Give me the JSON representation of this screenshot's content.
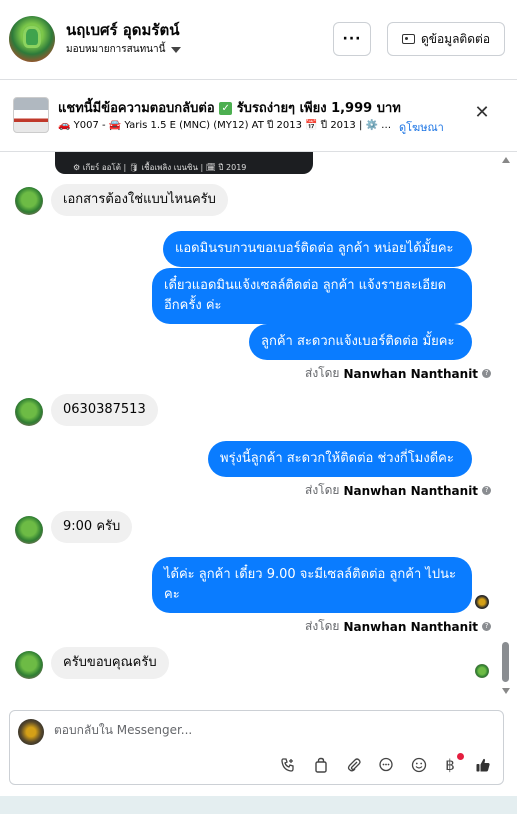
{
  "header": {
    "contact_name": "นฤเบศร์ อุดมรัตน์",
    "assign_label": "มอบหมายการสนทนานี้",
    "more_label": "···",
    "contact_button_label": "ดูข้อมูลติดต่อ"
  },
  "ad": {
    "title": "แชทนี้มีข้อความตอบกลับต่อ",
    "title_suffix": "รับรถง่ายๆ เพียง 1,999 บาท",
    "subtitle": "🚗 Y007 - 🚘 Yaris 1.5 E (MNC) (MY12) AT ปี 2013 📅 ปี 2013 | ⚙️ เ...",
    "view_ad_label": "ดูโฆษณา"
  },
  "media_caption": "⚙ เกียร์ ออโต้  |  🛢 เชื้อเพลิง เบนซิน  |  🗓 ปี 2019",
  "messages": [
    {
      "type": "in",
      "text": "เอกสารต้องใช่แบบไหนครับ"
    },
    {
      "type": "out",
      "text": "แอดมินรบกวนขอเบอร์ติดต่อ ลูกค้า หน่อยได้มั้ยคะ"
    },
    {
      "type": "out",
      "text": "เดี๋ยวแอดมินแจ้งเซลล์ติดต่อ ลูกค้า แจ้งรายละเอียดอีกครั้ง ค่ะ"
    },
    {
      "type": "out",
      "text": "ลูกค้า สะดวกแจ้งเบอร์ติดต่อ มั้ยคะ"
    },
    {
      "type": "in",
      "text": "0630387513"
    },
    {
      "type": "out",
      "text": "พรุ่งนี้ลูกค้า สะดวกให้ติดต่อ ช่วงกี่โมงดีคะ"
    },
    {
      "type": "in",
      "text": "9:00  ครับ"
    },
    {
      "type": "out",
      "text": "ได้ค่ะ  ลูกค้า เดี๋ยว 9.00 จะมีเซลล์ติดต่อ ลูกค้า ไปนะคะ"
    },
    {
      "type": "in",
      "text": "ครับขอบคุณครับ"
    }
  ],
  "sent_by": {
    "prefix": "ส่งโดย",
    "name": "Nanwhan Nanthanit"
  },
  "composer": {
    "placeholder": "ตอบกลับใน Messenger..."
  },
  "icons": {
    "more": "more-horizontal-icon",
    "contact": "contact-card-icon",
    "close": "close-icon",
    "call": "call-add-icon",
    "bag": "shopping-bag-icon",
    "attach": "paperclip-icon",
    "saved_reply": "chat-bubble-icon",
    "emoji": "emoji-icon",
    "payment": "baht-icon",
    "like": "thumbs-up-icon"
  },
  "colors": {
    "outgoing_bubble": "#0a7cff",
    "incoming_bubble": "#f0f0f0",
    "link": "#1b74e4"
  }
}
